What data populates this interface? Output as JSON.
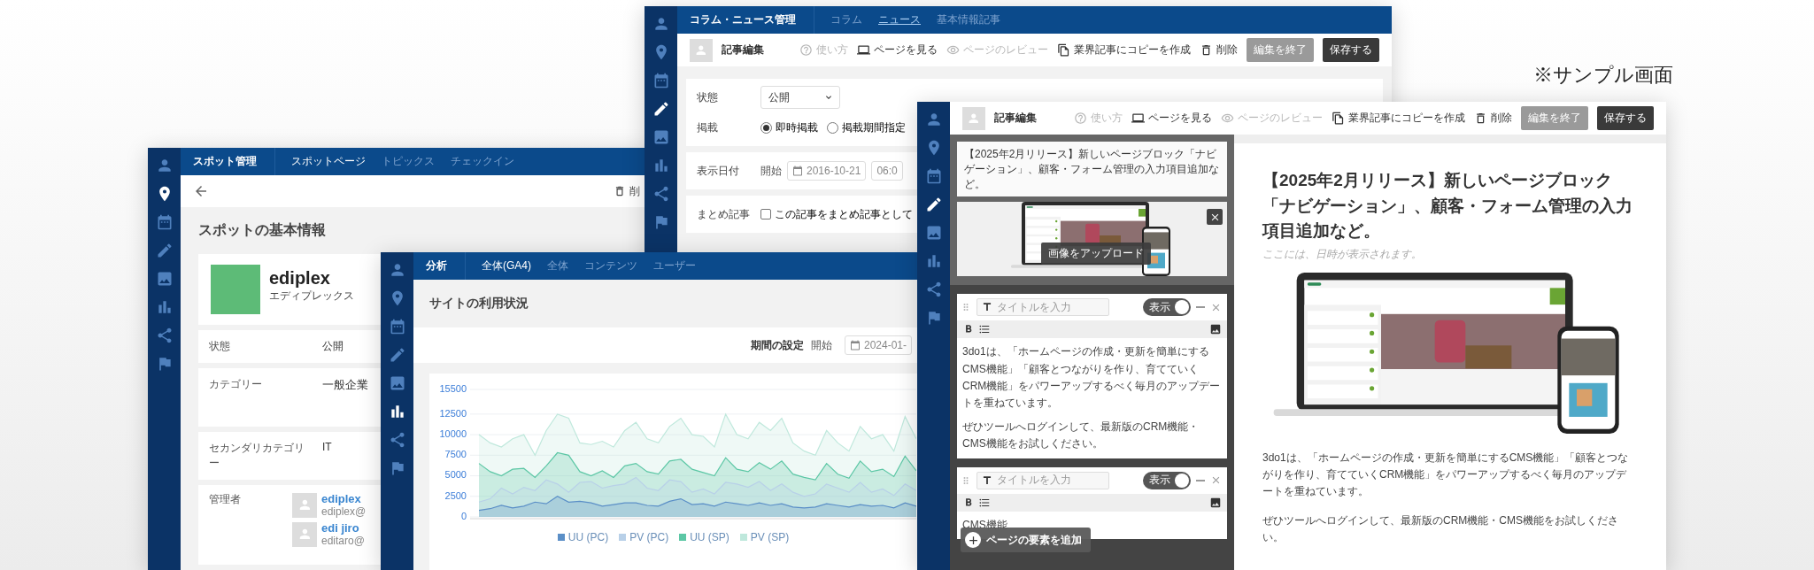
{
  "sample_label": "※サンプル画面",
  "spot_window": {
    "sidebar": [
      {
        "selected": false
      },
      {
        "selected": true
      },
      {
        "selected": false
      },
      {
        "selected": false
      },
      {
        "selected": false
      },
      {
        "selected": false
      },
      {
        "selected": false
      },
      {
        "selected": false
      }
    ],
    "section": "スポット管理",
    "tabs": [
      {
        "label": "スポットページ",
        "selected": true
      },
      {
        "label": "トピックス",
        "selected": false
      },
      {
        "label": "チェックイン",
        "selected": false
      }
    ],
    "delete_label": "削",
    "heading": "スポットの基本情報",
    "profile": {
      "name": "ediplex",
      "kana": "エディプレックス"
    },
    "fields": [
      {
        "label": "状態",
        "value": "公開"
      },
      {
        "label": "カテゴリー",
        "value": "一般企業"
      },
      {
        "label": "セカンダリカテゴリー",
        "value": "IT"
      }
    ],
    "admins_label": "管理者",
    "admins": [
      {
        "name": "ediplex",
        "email": "ediplex@"
      },
      {
        "name": "edi jiro",
        "email": "editaro@"
      }
    ]
  },
  "news_window": {
    "sidebar": [
      {
        "selected": false
      },
      {
        "selected": false
      },
      {
        "selected": false
      },
      {
        "selected": true
      },
      {
        "selected": false
      },
      {
        "selected": false
      },
      {
        "selected": false
      },
      {
        "selected": false
      }
    ],
    "section": "コラム・ニュース管理",
    "tabs": [
      {
        "label": "コラム",
        "selected": false
      },
      {
        "label": "ニュース",
        "selected": true
      },
      {
        "label": "基本情報記事",
        "selected": false
      }
    ],
    "title": "記事編集",
    "actions": [
      {
        "kind": "help",
        "label": "使い方",
        "disabled": true
      },
      {
        "kind": "view",
        "label": "ページを見る",
        "disabled": false
      },
      {
        "kind": "preview",
        "label": "ページのレビュー",
        "disabled": true
      },
      {
        "kind": "copy",
        "label": "業界記事にコピーを作成",
        "disabled": false
      },
      {
        "kind": "delete",
        "label": "削除",
        "disabled": false
      }
    ],
    "end_button": "編集を終了",
    "save_button": "保存する",
    "form": {
      "status_label": "状態",
      "status_value": "公開",
      "publish_label": "掲載",
      "publish_options": [
        {
          "label": "即時掲載",
          "selected": true
        },
        {
          "label": "掲載期間指定",
          "selected": false
        }
      ],
      "date_label": "表示日付",
      "date_start": "開始",
      "date_value": "2016-10-21",
      "time_value": "06:0",
      "summary_label": "まとめ記事",
      "summary_checkbox": {
        "label": "この記事をまとめ記事として",
        "checked": false
      }
    }
  },
  "analysis_window": {
    "sidebar": [
      {
        "selected": false
      },
      {
        "selected": false
      },
      {
        "selected": false
      },
      {
        "selected": false
      },
      {
        "selected": false
      },
      {
        "selected": true
      },
      {
        "selected": false
      },
      {
        "selected": false
      }
    ],
    "section": "分析",
    "tabs": [
      {
        "label": "全体(GA4)",
        "selected": true
      },
      {
        "label": "全体",
        "selected": false
      },
      {
        "label": "コンテンツ",
        "selected": false
      },
      {
        "label": "ユーザー",
        "selected": false
      }
    ],
    "heading": "サイトの利用状況",
    "period_label": "期間の設定",
    "start_label": "開始",
    "start_value": "2024-01-",
    "chart_data": {
      "type": "area",
      "ylim": [
        0,
        15500
      ],
      "grid": true,
      "legend": "bottom",
      "yticks": [
        0,
        2500,
        5000,
        7500,
        10000,
        12500,
        15500
      ],
      "series": [
        {
          "name": "UU (PC)",
          "color": "#5b8fc7",
          "values": [
            800,
            1000,
            1400,
            1100,
            1300,
            1800,
            1600,
            2500,
            1800,
            1900,
            1700,
            1300,
            1500,
            1700,
            1700,
            1400,
            1300,
            1900,
            2200,
            1500,
            1600,
            1300,
            1800,
            1600,
            1400,
            1700,
            1400,
            1600,
            1200,
            1100,
            1200,
            1600,
            1400,
            1200,
            1500,
            1300,
            1400,
            1100,
            1700,
            1300
          ]
        },
        {
          "name": "PV (PC)",
          "color": "#b8d0e8",
          "values": [
            1800,
            2200,
            3500,
            2800,
            3600,
            3200,
            4500,
            4000,
            3000,
            4200,
            4300,
            3500,
            3800,
            4000,
            4800,
            3500,
            3200,
            4500,
            4300,
            3000,
            3400,
            2800,
            4200,
            4000,
            3600,
            4300,
            3200,
            4000,
            3000,
            2500,
            2800,
            4000,
            3500,
            3000,
            4200,
            3000,
            3400,
            2600,
            4000,
            3200
          ]
        },
        {
          "name": "UU (SP)",
          "color": "#5cc7a5",
          "values": [
            6500,
            5500,
            5000,
            5800,
            5900,
            4800,
            6200,
            7800,
            7500,
            5500,
            5000,
            5600,
            4800,
            6200,
            6500,
            5500,
            5200,
            6800,
            7000,
            5800,
            5400,
            5000,
            7200,
            5800,
            5500,
            6600,
            5800,
            6800,
            5200,
            4800,
            4500,
            6500,
            5200,
            4700,
            6800,
            5500,
            5800,
            4900,
            7400,
            5600
          ]
        },
        {
          "name": "PV (SP)",
          "color": "#bfe8dc",
          "values": [
            10000,
            9000,
            8500,
            9500,
            10000,
            7500,
            10500,
            12500,
            12000,
            9000,
            8800,
            9200,
            8500,
            10500,
            11500,
            9500,
            9000,
            11000,
            12000,
            10000,
            9800,
            8500,
            12500,
            10000,
            9500,
            11500,
            10500,
            12000,
            9000,
            8000,
            7500,
            10500,
            9000,
            8000,
            11000,
            9500,
            10000,
            8000,
            12200,
            9500
          ]
        }
      ]
    }
  },
  "article_window": {
    "sidebar": [
      {
        "selected": false
      },
      {
        "selected": false
      },
      {
        "selected": false
      },
      {
        "selected": true
      },
      {
        "selected": false
      },
      {
        "selected": false
      },
      {
        "selected": false
      },
      {
        "selected": false
      }
    ],
    "title": "記事編集",
    "actions": [
      {
        "kind": "help",
        "label": "使い方",
        "disabled": true
      },
      {
        "kind": "view",
        "label": "ページを見る",
        "disabled": false
      },
      {
        "kind": "preview",
        "label": "ページのレビュー",
        "disabled": true
      },
      {
        "kind": "copy",
        "label": "業界記事にコピーを作成",
        "disabled": false
      },
      {
        "kind": "delete",
        "label": "削除",
        "disabled": false
      }
    ],
    "end_button": "編集を終了",
    "save_button": "保存する",
    "editor": {
      "title_text": "【2025年2月リリース】新しいページブロック「ナビゲーション」、顧客・フォーム管理の入力項目追加など。",
      "upload_button": "画像をアップロード",
      "blocks": [
        {
          "placeholder": "タイトルを入力",
          "toggle_label": "表示",
          "visible": true,
          "paragraphs": [
            "3do1は、「ホームページの作成・更新を簡単にするCMS機能」「顧客とつながりを作り、育てていくCRM機能」をパワーアップするべく毎月のアップデートを重ねています。",
            "ぜひツールへログインして、最新版のCRM機能・CMS機能をお試しください。"
          ]
        },
        {
          "placeholder": "タイトルを入力",
          "toggle_label": "表示",
          "visible": true,
          "paragraphs": [
            "CMS機能"
          ]
        }
      ],
      "add_button": "ページの要素を追加"
    },
    "preview": {
      "title": "【2025年2月リリース】新しいページブロック「ナビゲーション」、顧客・フォーム管理の入力項目追加など。",
      "date_note": "ここには、日時が表示されます。",
      "paragraphs": [
        "3do1は、「ホームページの作成・更新を簡単にするCMS機能」「顧客とつながりを作り、育てていくCRM機能」をパワーアップするべく毎月のアップデートを重ねています。",
        "ぜひツールへログインして、最新版のCRM機能・CMS機能をお試しください。"
      ]
    }
  }
}
